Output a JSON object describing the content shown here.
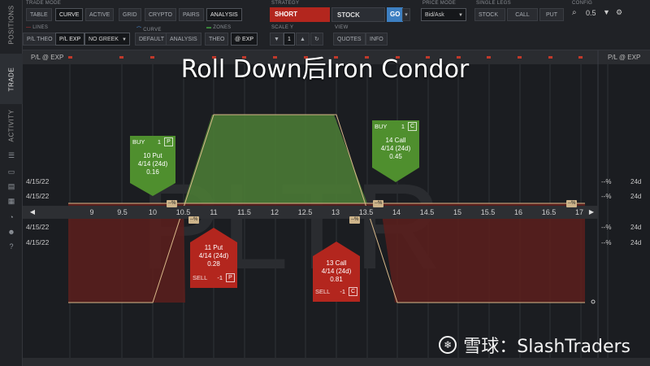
{
  "rail": {
    "tabs": [
      "POSITIONS",
      "TRADE",
      "ACTIVITY"
    ],
    "icons": [
      "list-icon",
      "folder-icon",
      "chart-icon",
      "grid-icon",
      "gauge-icon",
      "people-icon",
      "help-icon"
    ]
  },
  "toolbar": {
    "trade_mode_label": "TRADE MODE",
    "mode_tabs": [
      "TABLE",
      "CURVE",
      "ACTIVE",
      "GRID",
      "CRYPTO",
      "PAIRS",
      "ANALYSIS"
    ],
    "selected_mode": "CURVE",
    "lines_label": "LINES",
    "lines_buttons": [
      "P/L THEO",
      "P/L EXP"
    ],
    "greek_select": "NO GREEK",
    "curve_label": "CURVE",
    "curve_buttons": [
      "DEFAULT",
      "ANALYSIS"
    ],
    "zones_label": "ZONES",
    "zones_buttons": [
      "THEO",
      "@ EXP"
    ],
    "strategy_label": "STRATEGY",
    "strategy_side": "SHORT",
    "strategy_type": "STOCK",
    "go_label": "GO",
    "scale_label": "SCALE Y",
    "scale_value": "1",
    "view_label": "VIEW",
    "view_buttons": [
      "QUOTES",
      "INFO"
    ],
    "price_mode_label": "PRICE MODE",
    "price_mode_value": "Bid/Ask",
    "single_legs_label": "SINGLE LEGS",
    "single_legs_buttons": [
      "STOCK",
      "CALL",
      "PUT"
    ],
    "config_label": "CONFIG",
    "config_zoom": "0.5"
  },
  "chart": {
    "header_left": "P/L @ EXP",
    "header_right": "P/L @ EXP",
    "watermark_symbol": "PLTR",
    "dates_left": [
      "4/15/22",
      "4/15/22",
      "4/15/22",
      "4/15/22"
    ],
    "right_pct": [
      "--%",
      "--%",
      "--%",
      "--%"
    ],
    "right_days": [
      "24d",
      "24d",
      "24d",
      "24d"
    ],
    "pct_badge": "--%",
    "x_ticks": [
      "9",
      "9.5",
      "10",
      "10.5",
      "11",
      "11.5",
      "12",
      "12.5",
      "13",
      "13.5",
      "14",
      "14.5",
      "15",
      "15.5",
      "16",
      "16.5",
      "17"
    ]
  },
  "legs": [
    {
      "side": "BUY",
      "qty": "1",
      "type_code": "P",
      "desc": "10 Put",
      "exp": "4/14 (24d)",
      "price": "0.16",
      "color": "#4f8f2e"
    },
    {
      "side": "BUY",
      "qty": "1",
      "type_code": "C",
      "desc": "14 Call",
      "exp": "4/14 (24d)",
      "price": "0.45",
      "color": "#4f8f2e"
    },
    {
      "side": "SELL",
      "qty": "-1",
      "type_code": "P",
      "desc": "11 Put",
      "exp": "4/14 (24d)",
      "price": "0.28",
      "color": "#b3261e"
    },
    {
      "side": "SELL",
      "qty": "-1",
      "type_code": "C",
      "desc": "13 Call",
      "exp": "4/14 (24d)",
      "price": "0.81",
      "color": "#b3261e"
    }
  ],
  "overlay": {
    "title": "Roll Down后Iron Condor",
    "watermark_brand": "雪球：SlashTraders"
  },
  "colors": {
    "profit_fill": "#4a7a35",
    "loss_fill": "#5c1f1c",
    "short_red": "#b3261e",
    "buy_green": "#4f8f2e",
    "go_blue": "#3d7fc1"
  }
}
